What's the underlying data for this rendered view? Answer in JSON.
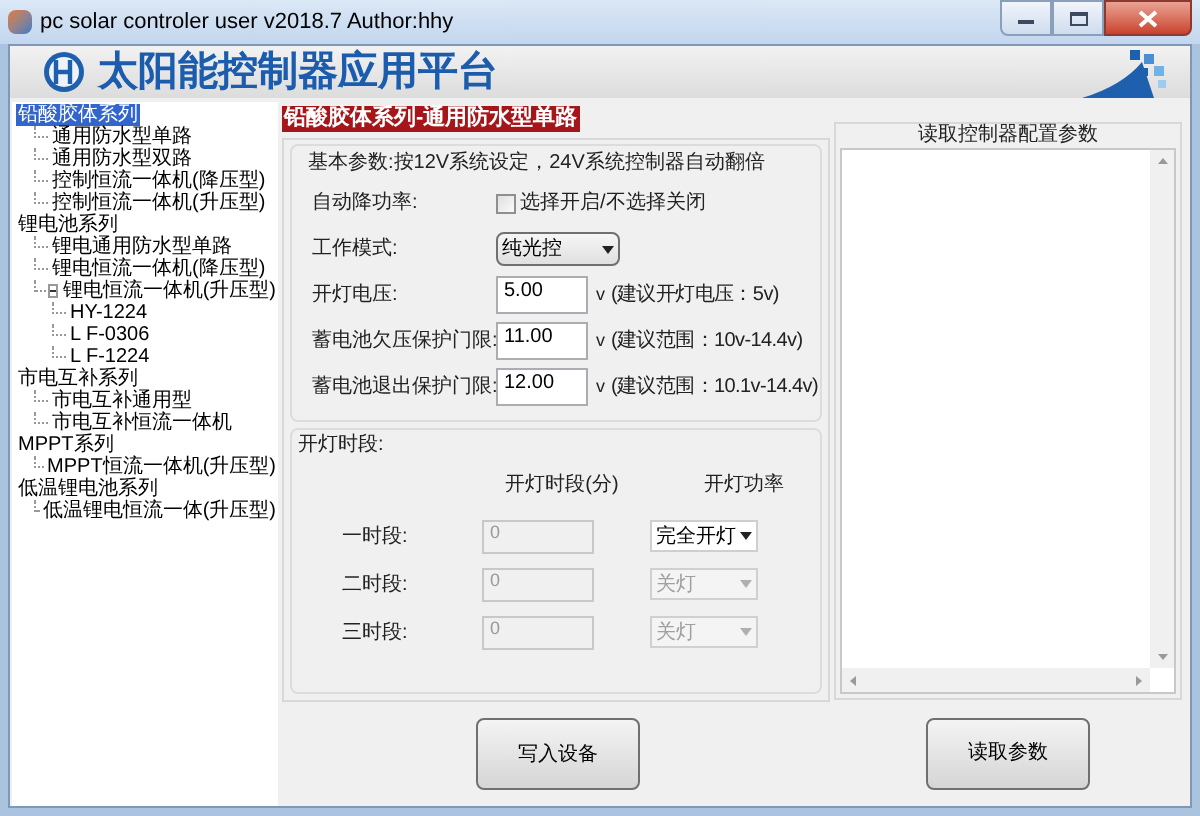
{
  "window": {
    "title": "pc solar controler user v2018.7 Author:hhy"
  },
  "banner": {
    "title": "太阳能控制器应用平台"
  },
  "tree": [
    {
      "label": "铅酸胶体系列",
      "selected": true,
      "children": [
        {
          "label": "通用防水型单路",
          "selected": false
        },
        {
          "label": "通用防水型双路",
          "selected": false
        },
        {
          "label": "控制恒流一体机(降压型)",
          "selected": false
        },
        {
          "label": "控制恒流一体机(升压型)",
          "selected": false
        }
      ]
    },
    {
      "label": "锂电池系列",
      "selected": false,
      "children": [
        {
          "label": "锂电通用防水型单路",
          "selected": false
        },
        {
          "label": "锂电恒流一体机(降压型)",
          "selected": false
        },
        {
          "label": "锂电恒流一体机(升压型)",
          "selected": false,
          "children": [
            {
              "label": "HY-1224",
              "selected": false
            },
            {
              "label": "L F-0306",
              "selected": false
            },
            {
              "label": "L F-1224",
              "selected": false
            }
          ]
        }
      ]
    },
    {
      "label": "市电互补系列",
      "selected": false,
      "children": [
        {
          "label": "市电互补通用型",
          "selected": false
        },
        {
          "label": "市电互补恒流一体机",
          "selected": false
        }
      ]
    },
    {
      "label": "MPPT系列",
      "selected": false,
      "children": [
        {
          "label": "MPPT恒流一体机(升压型)",
          "selected": false
        }
      ]
    },
    {
      "label": "低温锂电池系列",
      "selected": false,
      "children": [
        {
          "label": "低温锂电恒流一体(升压型)",
          "selected": false
        }
      ]
    }
  ],
  "section_title": "铅酸胶体系列-通用防水型单路",
  "basic_params": {
    "legend": "基本参数:按12V系统设定，24V系统控制器自动翻倍",
    "fields": [
      {
        "kind": "checkbox",
        "label": "自动降功率:",
        "checked": false,
        "text": "选择开启/不选择关闭"
      },
      {
        "kind": "select",
        "label": "工作模式:",
        "value": "纯光控"
      },
      {
        "kind": "number",
        "label": "开灯电压:",
        "value": "5.00",
        "unit": "v",
        "hint": "(建议开灯电压：5v)"
      },
      {
        "kind": "number",
        "label": "蓄电池欠压保护门限:",
        "value": "11.00",
        "unit": "v",
        "hint": "(建议范围：10v-14.4v)"
      },
      {
        "kind": "number",
        "label": "蓄电池退出保护门限:",
        "value": "12.00",
        "unit": "v",
        "hint": "(建议范围：10.1v-14.4v)"
      }
    ]
  },
  "light_schedule": {
    "legend": "开灯时段:",
    "columns": [
      "开灯时段(分)",
      "开灯功率"
    ],
    "rows": [
      {
        "label": "一时段:",
        "minutes": "0",
        "minutes_disabled": true,
        "power": "完全开灯",
        "power_disabled": false
      },
      {
        "label": "二时段:",
        "minutes": "0",
        "minutes_disabled": true,
        "power": "关灯",
        "power_disabled": true
      },
      {
        "label": "三时段:",
        "minutes": "0",
        "minutes_disabled": true,
        "power": "关灯",
        "power_disabled": true
      }
    ]
  },
  "config_panel": {
    "legend": "读取控制器配置参数"
  },
  "buttons": {
    "write": "写入设备",
    "read": "读取参数"
  }
}
